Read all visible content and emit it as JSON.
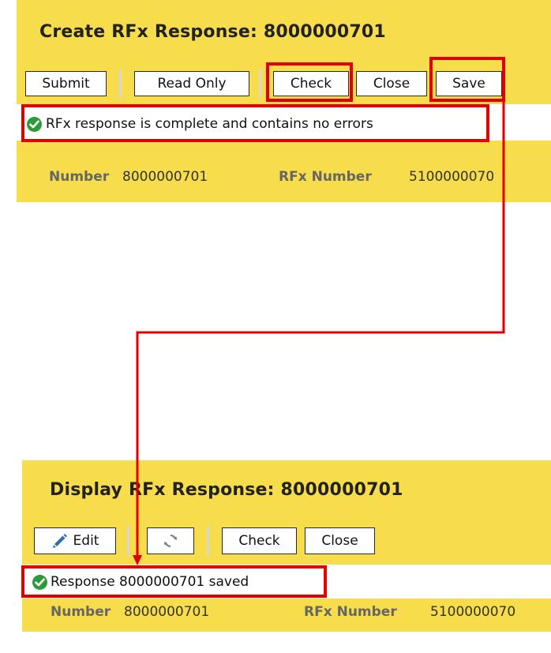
{
  "create_panel": {
    "title": "Create RFx Response: 8000000701",
    "toolbar": {
      "submit_label": "Submit",
      "read_only_label": "Read Only",
      "check_label": "Check",
      "close_label": "Close",
      "save_label": "Save"
    },
    "message": "RFx response  is complete and contains no errors",
    "fields": {
      "number_label": "Number",
      "number_value": "8000000701",
      "rfx_number_label": "RFx Number",
      "rfx_number_value": "5100000070"
    }
  },
  "display_panel": {
    "title": "Display RFx Response: 8000000701",
    "toolbar": {
      "edit_label": "Edit",
      "check_label": "Check",
      "close_label": "Close"
    },
    "message": "Response 8000000701 saved",
    "fields": {
      "number_label": "Number",
      "number_value": "8000000701",
      "rfx_number_label": "RFx Number",
      "rfx_number_value": "5100000070"
    }
  },
  "icons": {
    "success": "success-check-icon",
    "edit": "pencil-icon",
    "refresh": "refresh-icon"
  },
  "colors": {
    "header_yellow": "#f7dd4b",
    "highlight_red": "#e00000",
    "success_green": "#2e9b3b",
    "edit_blue": "#2f6db5"
  }
}
